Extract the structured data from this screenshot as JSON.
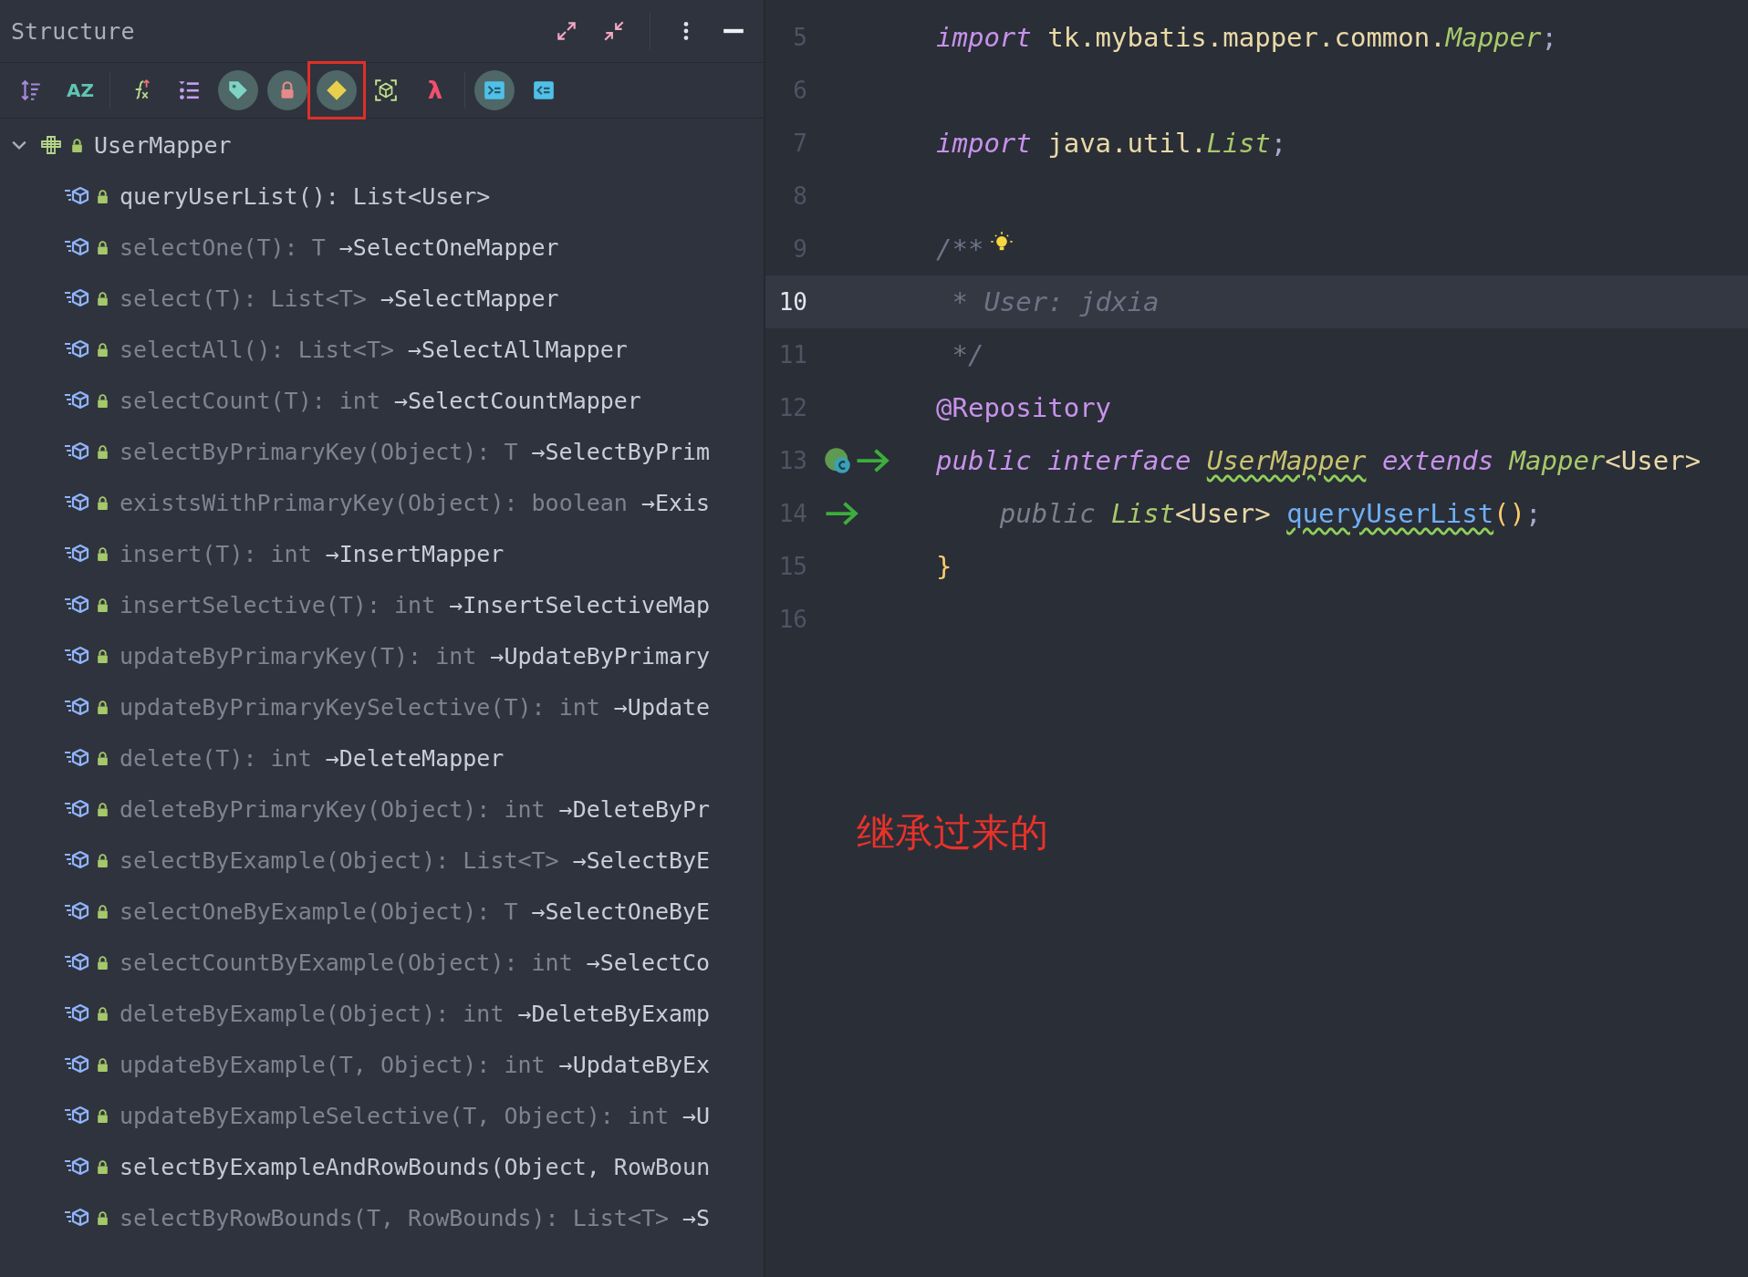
{
  "panel": {
    "title": "Structure",
    "header_groups": [
      [
        {
          "kind": "expand"
        },
        {
          "kind": "collapse"
        }
      ],
      [
        {
          "kind": "more"
        },
        {
          "kind": "minimize"
        }
      ]
    ]
  },
  "toolbar": [
    [
      {
        "kind": "sort",
        "selected": false,
        "highlighted": false
      },
      {
        "kind": "alpha",
        "glyph": "AZ",
        "selected": false,
        "highlighted": false
      }
    ],
    [
      {
        "kind": "function",
        "selected": false,
        "highlighted": false
      },
      {
        "kind": "list",
        "selected": false,
        "highlighted": false
      },
      {
        "kind": "tag",
        "selected": true,
        "highlighted": false
      },
      {
        "kind": "lock",
        "selected": true,
        "highlighted": false
      },
      {
        "kind": "diamond",
        "selected": true,
        "highlighted": true
      },
      {
        "kind": "cube",
        "selected": false,
        "highlighted": false
      },
      {
        "kind": "lambda",
        "glyph": "λ",
        "selected": false,
        "highlighted": false
      }
    ],
    [
      {
        "kind": "supertypes",
        "selected": true,
        "highlighted": false
      },
      {
        "kind": "subtypes",
        "selected": false,
        "highlighted": false
      }
    ]
  ],
  "tree": {
    "label": "UserMapper",
    "expanded": true,
    "children": [
      {
        "signature": "queryUserList(): List<User>"
      },
      {
        "signature": "selectOne(T): T",
        "origin": "→SelectOneMapper"
      },
      {
        "signature": "select(T): List<T>",
        "origin": "→SelectMapper"
      },
      {
        "signature": "selectAll(): List<T>",
        "origin": "→SelectAllMapper"
      },
      {
        "signature": "selectCount(T): int",
        "origin": "→SelectCountMapper"
      },
      {
        "signature": "selectByPrimaryKey(Object): T",
        "origin": "→SelectByPrim"
      },
      {
        "signature": "existsWithPrimaryKey(Object): boolean",
        "origin": "→Exis"
      },
      {
        "signature": "insert(T): int",
        "origin": "→InsertMapper"
      },
      {
        "signature": "insertSelective(T): int",
        "origin": "→InsertSelectiveMap"
      },
      {
        "signature": "updateByPrimaryKey(T): int",
        "origin": "→UpdateByPrimary"
      },
      {
        "signature": "updateByPrimaryKeySelective(T): int",
        "origin": "→Update"
      },
      {
        "signature": "delete(T): int",
        "origin": "→DeleteMapper"
      },
      {
        "signature": "deleteByPrimaryKey(Object): int",
        "origin": "→DeleteByPr"
      },
      {
        "signature": "selectByExample(Object): List<T>",
        "origin": "→SelectByE"
      },
      {
        "signature": "selectOneByExample(Object): T",
        "origin": "→SelectOneByE"
      },
      {
        "signature": "selectCountByExample(Object): int",
        "origin": "→SelectCo"
      },
      {
        "signature": "deleteByExample(Object): int",
        "origin": "→DeleteByExamp"
      },
      {
        "signature": "updateByExample(T, Object): int",
        "origin": "→UpdateByEx"
      },
      {
        "signature": "updateByExampleSelective(T, Object): int",
        "origin": "→U"
      },
      {
        "signature": "selectByExampleAndRowBounds(Object, RowBoun"
      },
      {
        "signature": "selectByRowBounds(T, RowBounds): List<T>",
        "origin": "→S"
      }
    ]
  },
  "editor": {
    "lines": [
      {
        "number": "5",
        "current": false,
        "tokens": [
          {
            "text": "import",
            "kind": "kw"
          },
          {
            "text": " tk.mybatis.mapper.common.",
            "kind": "pkg"
          },
          {
            "text": "Mapper",
            "kind": "type"
          },
          {
            "text": ";",
            "kind": "punct"
          }
        ]
      },
      {
        "number": "6",
        "current": false
      },
      {
        "number": "7",
        "current": false,
        "tokens": [
          {
            "text": "import",
            "kind": "kw"
          },
          {
            "text": " java.util.",
            "kind": "pkg"
          },
          {
            "text": "List",
            "kind": "type"
          },
          {
            "text": ";",
            "kind": "punct"
          }
        ]
      },
      {
        "number": "8",
        "current": false
      },
      {
        "number": "9",
        "current": false,
        "bulb": true,
        "tokens": [
          {
            "text": "/**",
            "kind": "comment"
          }
        ]
      },
      {
        "number": "10",
        "current": true,
        "tokens": [
          {
            "text": " * User: jdxia",
            "kind": "comment"
          }
        ]
      },
      {
        "number": "11",
        "current": false,
        "tokens": [
          {
            "text": " */",
            "kind": "comment"
          }
        ]
      },
      {
        "number": "12",
        "current": false,
        "tokens": [
          {
            "text": "@Repository",
            "kind": "annot"
          }
        ]
      },
      {
        "number": "13",
        "current": false,
        "gutter": [
          {
            "kind": "class"
          },
          {
            "kind": "arrow"
          }
        ],
        "tokens": [
          {
            "text": "public interface ",
            "kind": "kw"
          },
          {
            "text": "UserMapper",
            "kind": "ident",
            "squiggle": true
          },
          {
            "text": " extends ",
            "kind": "kw"
          },
          {
            "text": "Mapper",
            "kind": "type"
          },
          {
            "text": "<User>",
            "kind": "pkg"
          }
        ]
      },
      {
        "number": "14",
        "current": false,
        "gutter": [
          {
            "kind": "arrow"
          }
        ],
        "tokens": [
          {
            "text": "    public ",
            "kind": "dimkw"
          },
          {
            "text": "List",
            "kind": "type"
          },
          {
            "text": "<User> ",
            "kind": "pkg"
          },
          {
            "text": "queryUserList",
            "kind": "method",
            "squiggle": true
          },
          {
            "text": "()",
            "kind": "brace"
          },
          {
            "text": ";",
            "kind": "punct"
          }
        ]
      },
      {
        "number": "15",
        "current": false,
        "tokens": [
          {
            "text": "}",
            "kind": "brace"
          }
        ]
      },
      {
        "number": "16",
        "current": false
      }
    ]
  },
  "annotation": "继承过来的"
}
